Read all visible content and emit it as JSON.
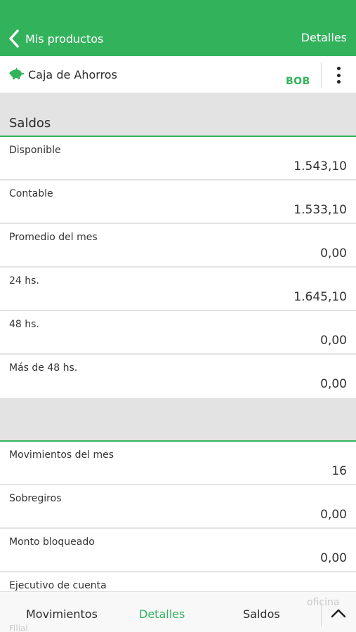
{
  "header": {
    "back_label": "Mis productos",
    "title": "Detalles",
    "color": "#33b25c"
  },
  "product": {
    "icon": "piggy-bank-icon",
    "name": "Caja de Ahorros",
    "currency": "BOB"
  },
  "balances": {
    "title": "Saldos",
    "rows": [
      {
        "label": "Disponible",
        "value": "1.543,10"
      },
      {
        "label": "Contable",
        "value": "1.533,10"
      },
      {
        "label": "Promedio del mes",
        "value": "0,00"
      },
      {
        "label": "24 hs.",
        "value": "1.645,10"
      },
      {
        "label": "48 hs.",
        "value": "0,00"
      },
      {
        "label": "Más de 48 hs.",
        "value": "0,00"
      }
    ]
  },
  "details": {
    "rows": [
      {
        "label": "Movimientos del mes",
        "value": "16"
      },
      {
        "label": "Sobregiros",
        "value": "0,00"
      },
      {
        "label": "Monto bloqueado",
        "value": "0,00"
      },
      {
        "label": "Ejecutivo de cuenta",
        "value": ""
      }
    ],
    "partial_labels": [
      "Filial",
      "oficina"
    ]
  },
  "tabs": [
    {
      "label": "Movimientos"
    },
    {
      "label": "Detalles",
      "active": true
    },
    {
      "label": "Saldos"
    }
  ]
}
